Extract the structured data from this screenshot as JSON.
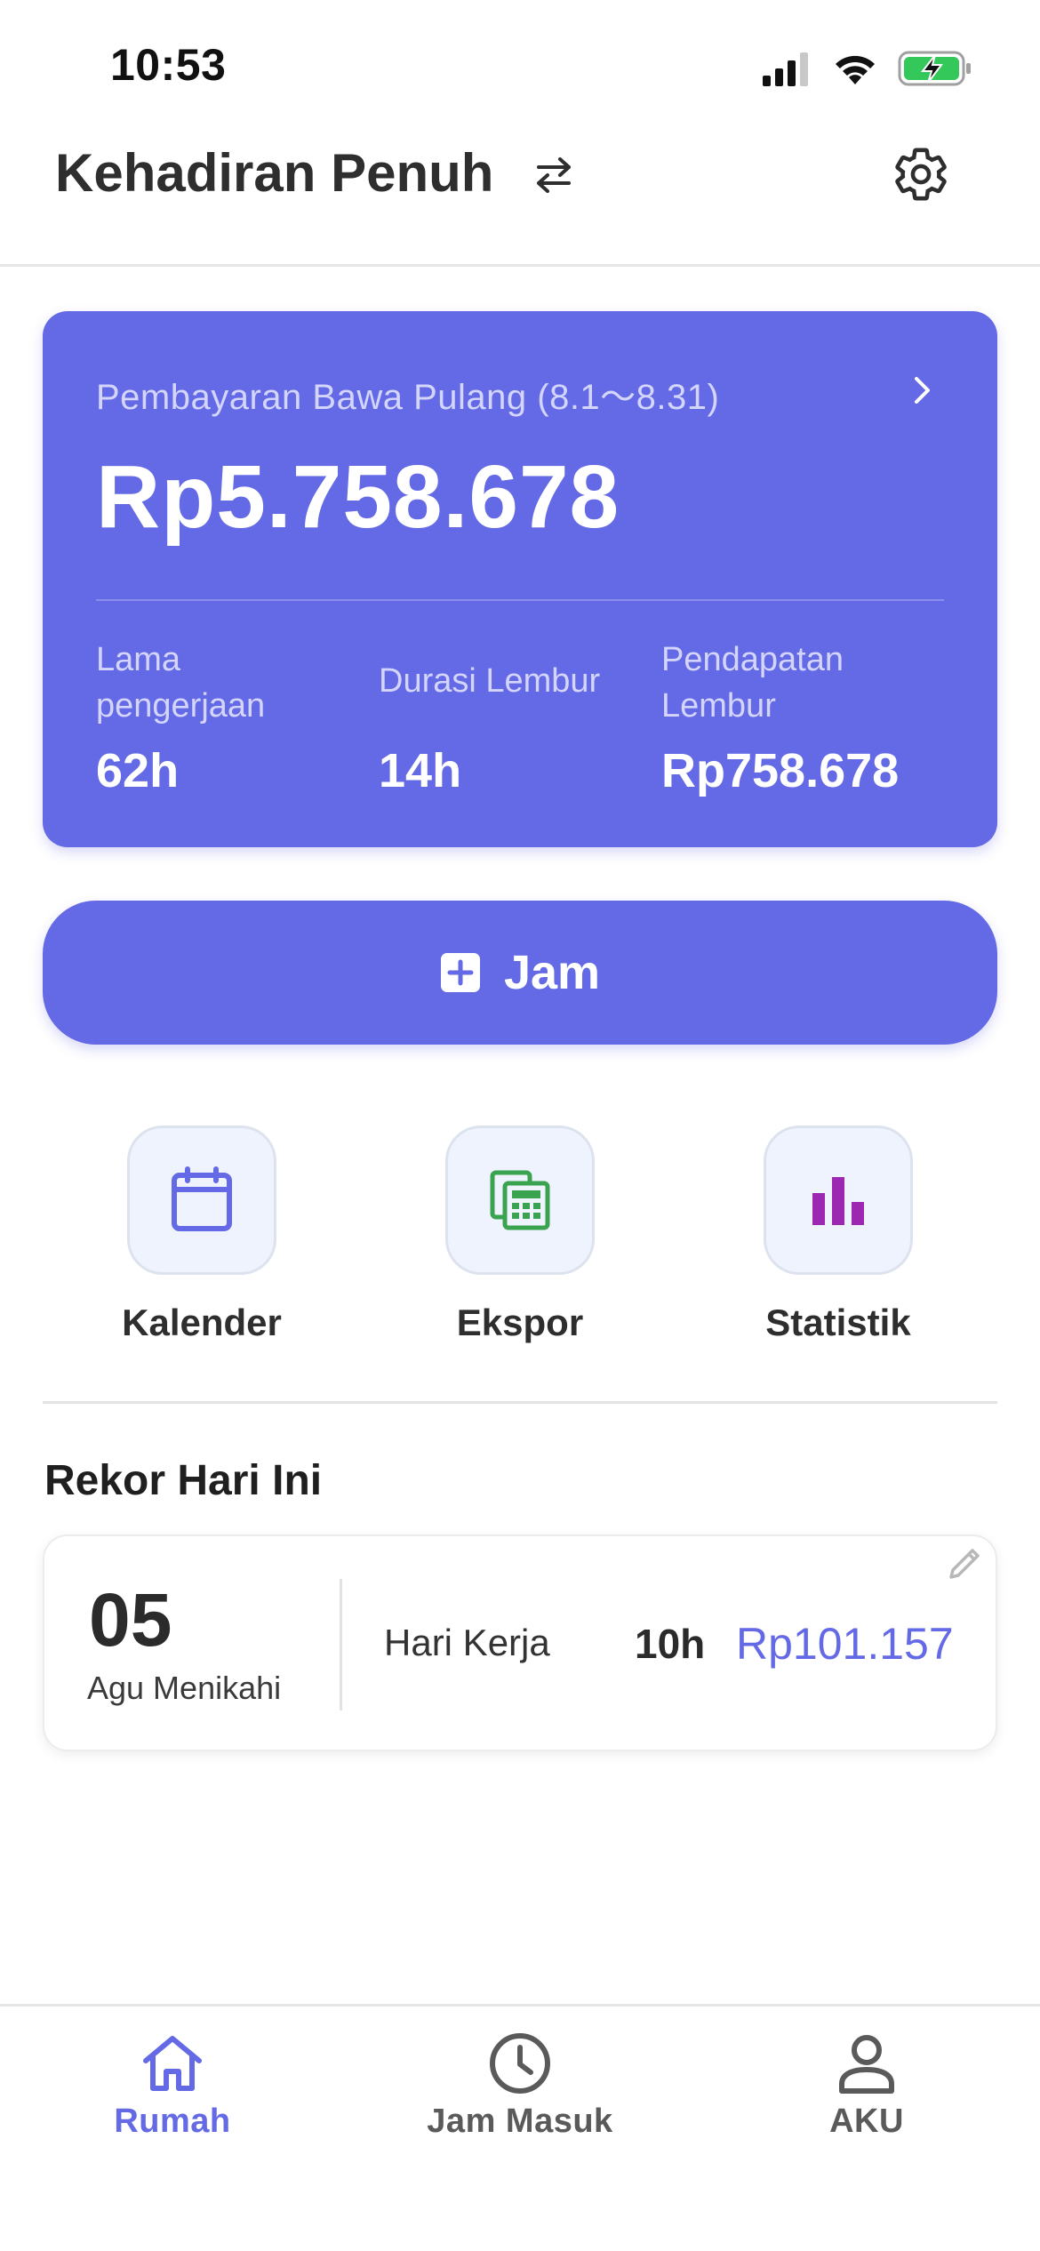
{
  "status_bar": {
    "time": "10:53"
  },
  "header": {
    "title": "Kehadiran Penuh",
    "swap_icon": "swap-arrows-icon",
    "settings_icon": "gear-icon"
  },
  "pay_card": {
    "period_label": "Pembayaran Bawa Pulang (8.1～8.31)",
    "total": "Rp5.758.678",
    "stats": [
      {
        "label": "Lama pengerjaan",
        "value": "62h"
      },
      {
        "label": "Durasi Lembur",
        "value": "14h"
      },
      {
        "label": "Pendapatan Lembur",
        "value": "Rp758.678"
      }
    ]
  },
  "clock_button": {
    "label": "Jam",
    "icon": "plus-square-icon"
  },
  "actions": [
    {
      "label": "Kalender",
      "icon": "calendar-icon",
      "color": "#6469e5"
    },
    {
      "label": "Ekspor",
      "icon": "spreadsheet-icon",
      "color": "#3aa350"
    },
    {
      "label": "Statistik",
      "icon": "bar-chart-icon",
      "color": "#9c27b0"
    }
  ],
  "today": {
    "section_title": "Rekor Hari Ini",
    "record": {
      "day": "05",
      "subtitle": "Agu Menikahi",
      "type": "Hari Kerja",
      "hours": "10h",
      "amount": "Rp101.157"
    }
  },
  "bottom_nav": [
    {
      "label": "Rumah",
      "icon": "home-icon",
      "active": true
    },
    {
      "label": "Jam Masuk",
      "icon": "clock-icon",
      "active": false
    },
    {
      "label": "AKU",
      "icon": "user-icon",
      "active": false
    }
  ],
  "colors": {
    "accent": "#6469e5",
    "export_green": "#3aa350",
    "stats_purple": "#9c27b0"
  }
}
